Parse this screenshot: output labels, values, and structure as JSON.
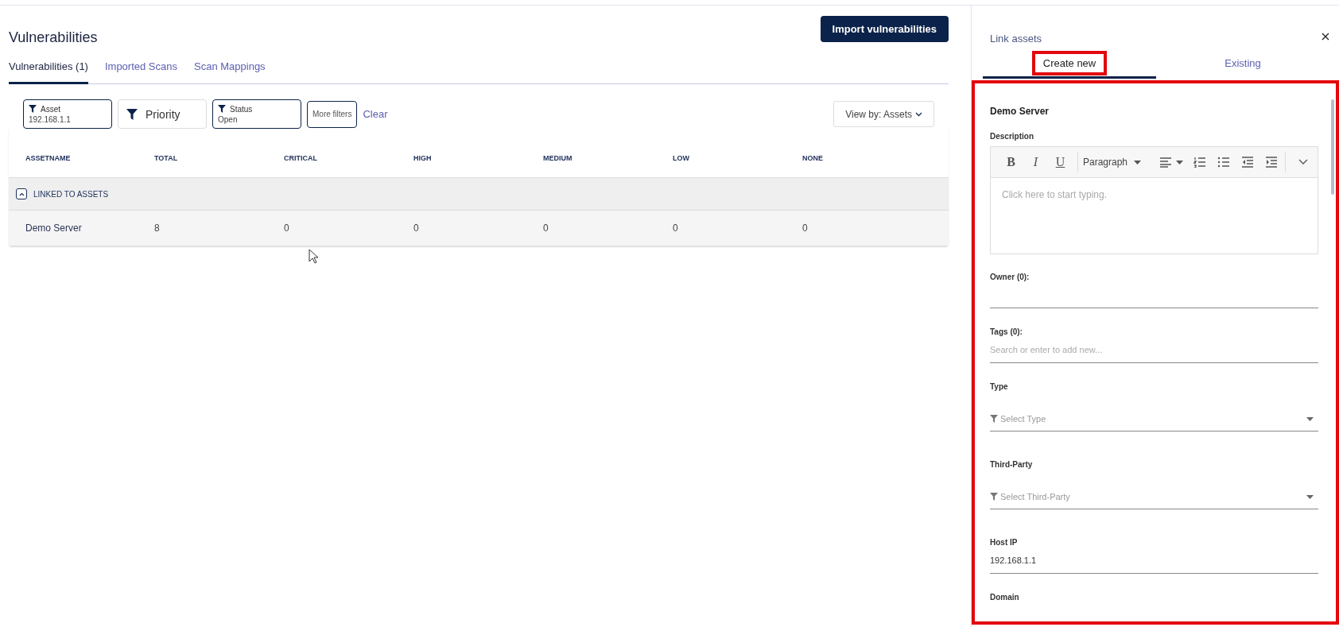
{
  "page": {
    "title": "Vulnerabilities",
    "import_button": "Import vulnerabilities"
  },
  "tabs": [
    {
      "label": "Vulnerabilities (1)",
      "selected": true
    },
    {
      "label": "Imported Scans",
      "selected": false
    },
    {
      "label": "Scan Mappings",
      "selected": false
    }
  ],
  "filters": [
    {
      "kind": "labeled",
      "label": "Asset",
      "value": "192.168.1.1"
    },
    {
      "kind": "plain",
      "label": "Priority"
    },
    {
      "kind": "labeled",
      "label": "Status",
      "value": "Open"
    },
    {
      "kind": "button",
      "label": "More filters"
    },
    {
      "kind": "link",
      "label": "Clear"
    }
  ],
  "view_by": "View by: Assets",
  "table": {
    "columns": [
      "ASSETNAME",
      "TOTAL",
      "CRITICAL",
      "HIGH",
      "MEDIUM",
      "LOW",
      "NONE"
    ],
    "groups": [
      {
        "label": "LINKED TO ASSETS",
        "expanded": true,
        "rows": [
          [
            "Demo Server",
            "8",
            "0",
            "0",
            "0",
            "0",
            "0"
          ]
        ]
      }
    ]
  },
  "panel": {
    "title": "Link assets",
    "tabs": [
      {
        "label": "Create new",
        "selected": true,
        "highlighted": true
      },
      {
        "label": "Existing",
        "selected": false,
        "highlighted": false
      }
    ],
    "form_highlighted": true,
    "asset_name": "Demo Server",
    "fields": [
      {
        "kind": "editor",
        "label": "Description",
        "placeholder": "Click here to start typing.",
        "toolbar": [
          "B",
          "I",
          "U"
        ],
        "format": "Paragraph"
      },
      {
        "kind": "text",
        "label": "Owner (0):"
      },
      {
        "kind": "text",
        "label": "Tags (0):",
        "placeholder": "Search or enter to add new..."
      },
      {
        "kind": "select",
        "label": "Type",
        "placeholder": "Select Type"
      },
      {
        "kind": "select",
        "label": "Third-Party",
        "placeholder": "Select Third-Party"
      },
      {
        "kind": "text",
        "label": "Host IP",
        "value": "192.168.1.1"
      },
      {
        "kind": "heading",
        "label": "Domain"
      }
    ]
  }
}
